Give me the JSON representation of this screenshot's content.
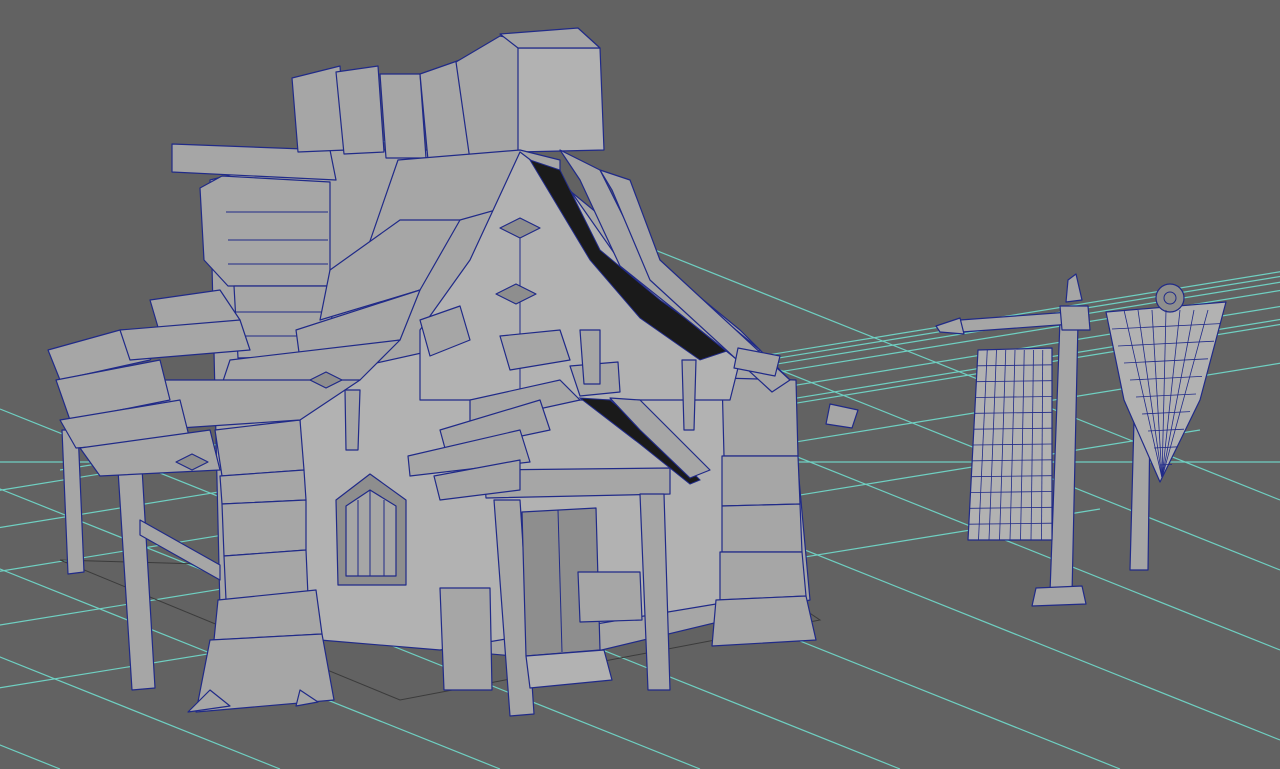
{
  "viewport": {
    "panel": "maya-perspective-viewport",
    "colors": {
      "background": "#626262",
      "grid": "#6fd0c2",
      "mesh_fill": "#a6a6a6",
      "wireframe": "#202a88"
    },
    "scene_objects": [
      "stylized-house-model",
      "banner-on-pole",
      "banner-scarecrow-pole"
    ],
    "display_mode": "wireframe-on-shaded",
    "grid_visible": true
  }
}
